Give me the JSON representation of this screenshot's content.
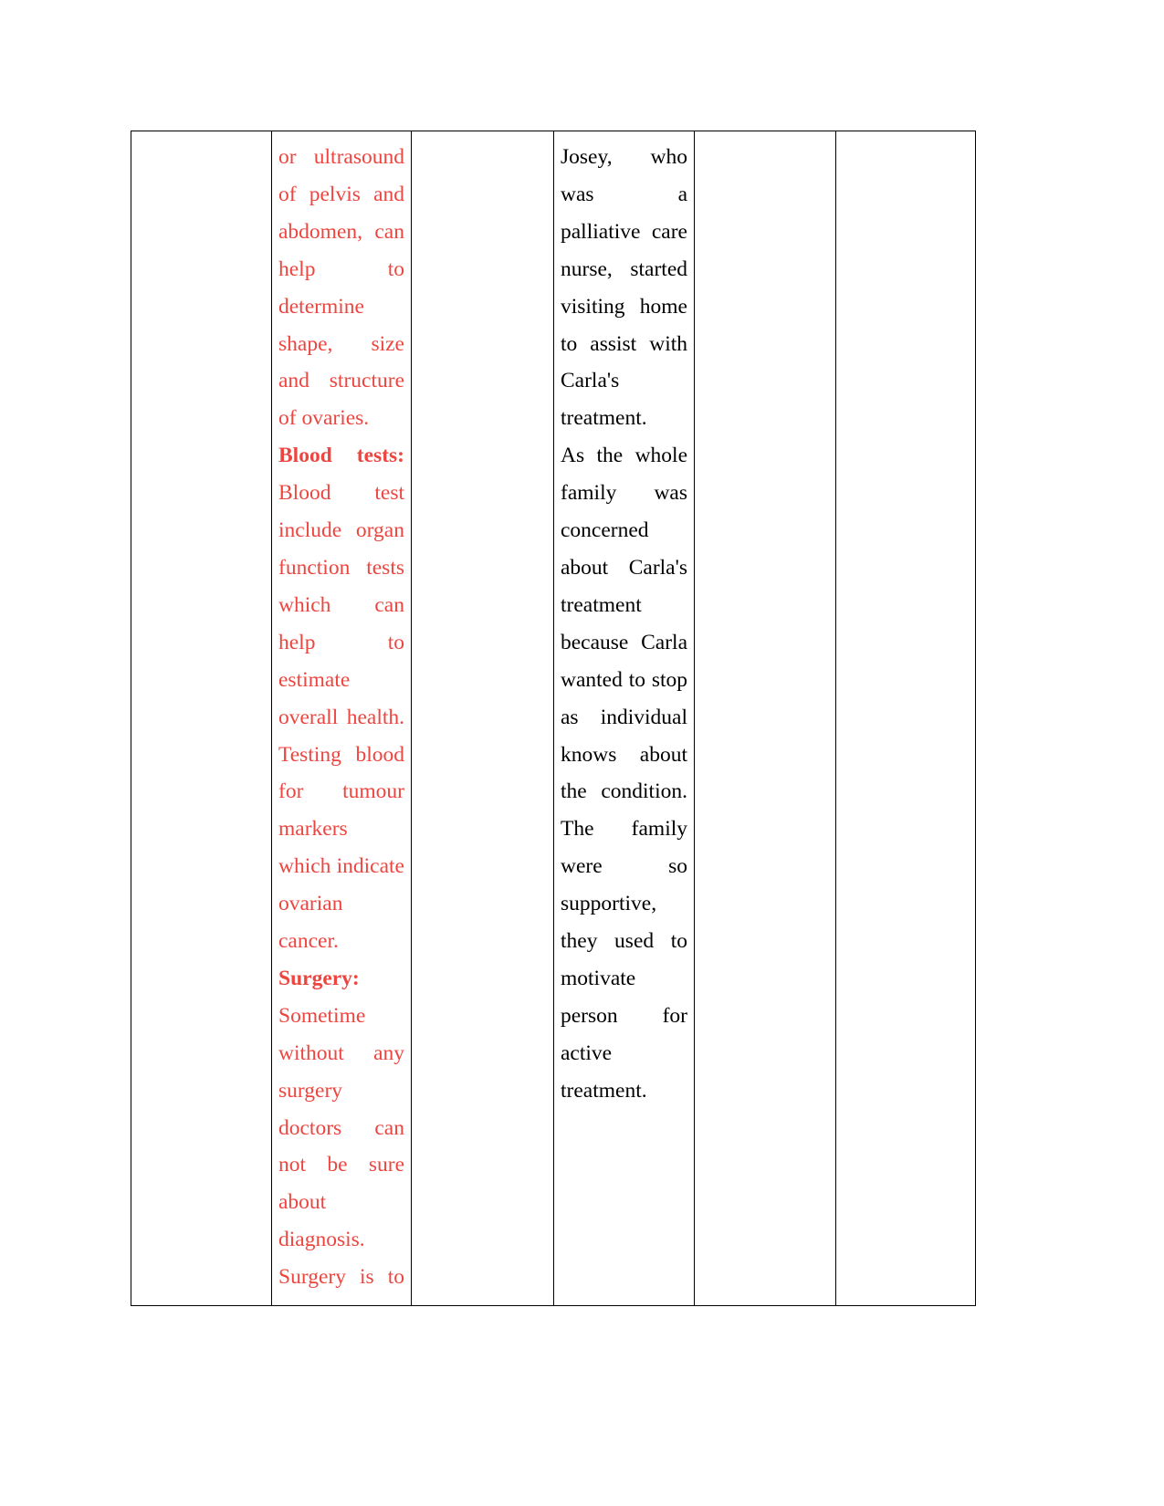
{
  "document": {
    "type": "table",
    "page_background": "#ffffff",
    "border_color": "#000000",
    "columns": 6,
    "accent_red": "#ED453F",
    "body_black": "#000000"
  },
  "table": {
    "cells": {
      "col1": {
        "name": "empty-cell-1",
        "lines": []
      },
      "col2": {
        "name": "red-content-cell",
        "color": "#ED453F",
        "lines": [
          {
            "text": "or   ultrasound",
            "bold": false,
            "justify": true
          },
          {
            "text": "of  pelvis  and",
            "bold": false,
            "justify": true
          },
          {
            "text": "abdomen,   can",
            "bold": false,
            "justify": true
          },
          {
            "text": "help              to",
            "bold": false,
            "justify": true
          },
          {
            "text": "determine",
            "bold": false,
            "justify": false
          },
          {
            "text": "shape,        size",
            "bold": false,
            "justify": true
          },
          {
            "text": "and   structure",
            "bold": false,
            "justify": true
          },
          {
            "text": "of ovaries.",
            "bold": false,
            "justify": false
          },
          {
            "text": "Blood     tests:",
            "bold": true,
            "justify": true
          },
          {
            "text": "Blood        test",
            "bold": false,
            "justify": true
          },
          {
            "text": "include  organ",
            "bold": false,
            "justify": true
          },
          {
            "text": "function   tests",
            "bold": false,
            "justify": true
          },
          {
            "text": "which          can",
            "bold": false,
            "justify": true
          },
          {
            "text": "help              to",
            "bold": false,
            "justify": true
          },
          {
            "text": "estimate",
            "bold": false,
            "justify": false
          },
          {
            "text": "overall health.",
            "bold": false,
            "justify": true
          },
          {
            "text": "Testing  blood",
            "bold": false,
            "justify": true
          },
          {
            "text": "for         tumour",
            "bold": false,
            "justify": true
          },
          {
            "text": "markers",
            "bold": false,
            "justify": false
          },
          {
            "text": "which indicate",
            "bold": false,
            "justify": true
          },
          {
            "text": "ovarian",
            "bold": false,
            "justify": false
          },
          {
            "text": "cancer.",
            "bold": false,
            "justify": false
          },
          {
            "text": "Surgery:",
            "bold": true,
            "justify": false
          },
          {
            "text": "Sometime",
            "bold": false,
            "justify": false
          },
          {
            "text": "without      any",
            "bold": false,
            "justify": true
          },
          {
            "text": "surgery",
            "bold": false,
            "justify": false
          },
          {
            "text": "doctors       can",
            "bold": false,
            "justify": true
          },
          {
            "text": "not   be    sure",
            "bold": false,
            "justify": true
          },
          {
            "text": "about",
            "bold": false,
            "justify": false
          },
          {
            "text": "diagnosis.",
            "bold": false,
            "justify": false
          },
          {
            "text": "Surgery  is  to",
            "bold": false,
            "justify": true
          }
        ]
      },
      "col3": {
        "name": "empty-cell-3",
        "lines": []
      },
      "col4": {
        "name": "black-content-cell",
        "color": "#000000",
        "lines": [
          {
            "text": "Josey,        who",
            "bold": false,
            "justify": true
          },
          {
            "text": "was                 a",
            "bold": false,
            "justify": true
          },
          {
            "text": "palliative  care",
            "bold": false,
            "justify": true
          },
          {
            "text": "nurse,   started",
            "bold": false,
            "justify": true
          },
          {
            "text": "visiting   home",
            "bold": false,
            "justify": true
          },
          {
            "text": "to  assist  with",
            "bold": false,
            "justify": true
          },
          {
            "text": "Carla's",
            "bold": false,
            "justify": false
          },
          {
            "text": "treatment.",
            "bold": false,
            "justify": false
          },
          {
            "text": "As  the  whole",
            "bold": false,
            "justify": true
          },
          {
            "text": "family         was",
            "bold": false,
            "justify": true
          },
          {
            "text": "concerned",
            "bold": false,
            "justify": false
          },
          {
            "text": "about    Carla's",
            "bold": false,
            "justify": true
          },
          {
            "text": "treatment",
            "bold": false,
            "justify": false
          },
          {
            "text": "because  Carla",
            "bold": false,
            "justify": true
          },
          {
            "text": "wanted to stop",
            "bold": false,
            "justify": true
          },
          {
            "text": "as     individual",
            "bold": false,
            "justify": true
          },
          {
            "text": "knows     about",
            "bold": false,
            "justify": true
          },
          {
            "text": "the  condition.",
            "bold": false,
            "justify": true
          },
          {
            "text": "The         family",
            "bold": false,
            "justify": true
          },
          {
            "text": "were               so",
            "bold": false,
            "justify": true
          },
          {
            "text": "supportive,",
            "bold": false,
            "justify": false
          },
          {
            "text": "they   used   to",
            "bold": false,
            "justify": true
          },
          {
            "text": "motivate",
            "bold": false,
            "justify": false
          },
          {
            "text": "person         for",
            "bold": false,
            "justify": true
          },
          {
            "text": "active",
            "bold": false,
            "justify": false
          },
          {
            "text": "treatment.",
            "bold": false,
            "justify": false
          }
        ]
      },
      "col5": {
        "name": "empty-cell-5",
        "lines": []
      },
      "col6": {
        "name": "empty-cell-6",
        "lines": []
      }
    }
  }
}
